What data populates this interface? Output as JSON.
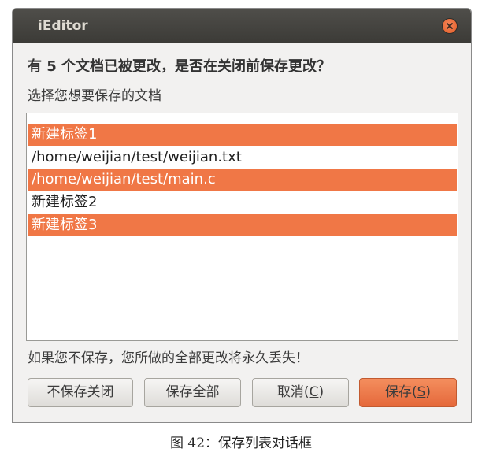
{
  "window": {
    "title": "iEditor"
  },
  "dialog": {
    "heading": "有 5 个文档已被更改，是否在关闭前保存更改？",
    "subheading": "选择您想要保存的文档",
    "warning": "如果您不保存，您所做的全部更改将永久丢失！",
    "documents": [
      {
        "label": "新建标签1",
        "selected": true
      },
      {
        "label": "/home/weijian/test/weijian.txt",
        "selected": false
      },
      {
        "label": "/home/weijian/test/main.c",
        "selected": true
      },
      {
        "label": "新建标签2",
        "selected": false
      },
      {
        "label": "新建标签3",
        "selected": true
      }
    ]
  },
  "buttons": {
    "close_without_save": "不保存关闭",
    "save_all": "保存全部",
    "cancel_prefix": "取消(",
    "cancel_key": "C",
    "cancel_suffix": ")",
    "save_prefix": "保存(",
    "save_key": "S",
    "save_suffix": ")"
  },
  "caption": "图 42：保存列表对话框",
  "colors": {
    "titlebar": "#3c3b37",
    "selection": "#f07746",
    "close_button": "#e05b25",
    "primary_button": "#e5683a"
  },
  "icons": {
    "close": "close-icon"
  }
}
